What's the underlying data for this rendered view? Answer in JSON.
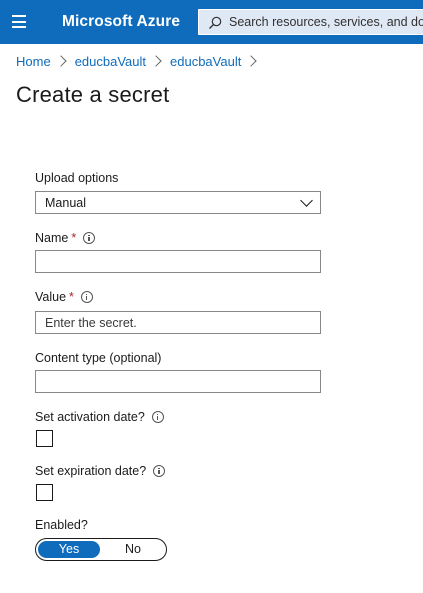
{
  "header": {
    "brand": "Microsoft Azure",
    "search_placeholder": "Search resources, services, and do"
  },
  "breadcrumb": [
    "Home",
    "educbaVault",
    "educbaVault"
  ],
  "page_title": "Create a secret",
  "form": {
    "upload_options": {
      "label": "Upload options",
      "value": "Manual"
    },
    "name": {
      "label": "Name",
      "required_mark": "*",
      "value": ""
    },
    "value": {
      "label": "Value",
      "required_mark": "*",
      "placeholder": "Enter the secret."
    },
    "content_type": {
      "label": "Content type (optional)",
      "value": ""
    },
    "activation": {
      "label": "Set activation date?",
      "checked": false
    },
    "expiration": {
      "label": "Set expiration date?",
      "checked": false
    },
    "enabled": {
      "label": "Enabled?",
      "options": [
        "Yes",
        "No"
      ],
      "selected": "Yes"
    }
  },
  "colors": {
    "accent": "#0f6cbd",
    "required": "#a4262c"
  }
}
